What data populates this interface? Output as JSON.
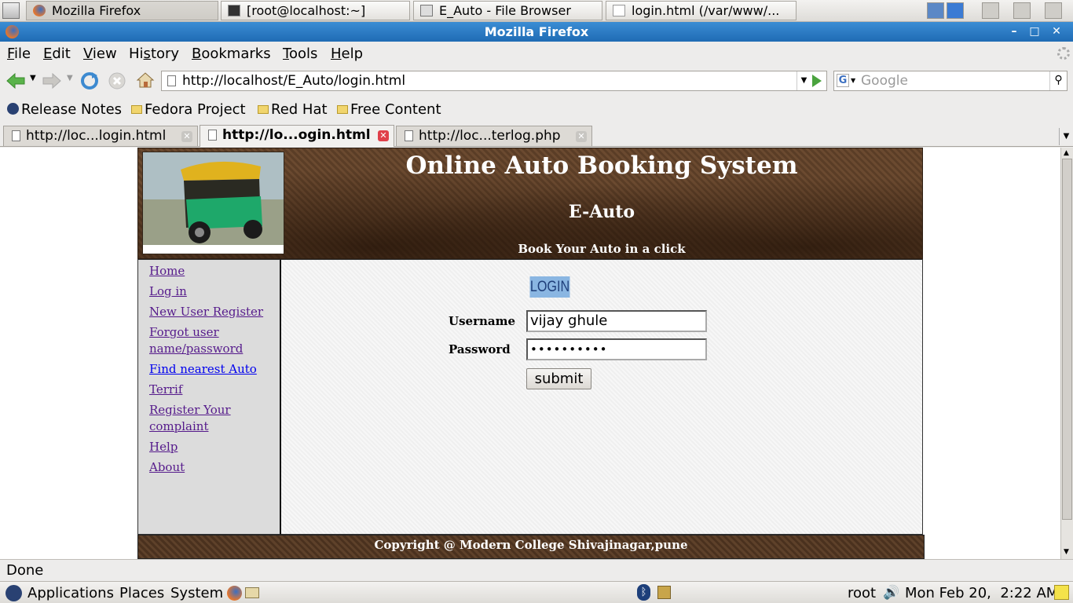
{
  "taskbar": {
    "tasks": [
      {
        "label": "Mozilla Firefox"
      },
      {
        "label": "[root@localhost:~]"
      },
      {
        "label": "E_Auto - File Browser"
      },
      {
        "label": "login.html (/var/www/..."
      }
    ]
  },
  "window": {
    "title": "Mozilla Firefox",
    "min": "–",
    "max": "□",
    "close": "✕"
  },
  "menubar": {
    "file": {
      "u": "F",
      "rest": "ile"
    },
    "edit": {
      "u": "E",
      "rest": "dit"
    },
    "view": {
      "u": "V",
      "rest": "iew"
    },
    "history": {
      "pre": "Hi",
      "u": "s",
      "rest": "tory"
    },
    "bookmarks": {
      "u": "B",
      "rest": "ookmarks"
    },
    "tools": {
      "u": "T",
      "rest": "ools"
    },
    "help": {
      "u": "H",
      "rest": "elp"
    }
  },
  "navbar": {
    "url": "http://localhost/E_Auto/login.html",
    "search_placeholder": "Google"
  },
  "bookmarks": [
    {
      "label": "Release Notes"
    },
    {
      "label": "Fedora Project"
    },
    {
      "label": "Red Hat"
    },
    {
      "label": "Free Content"
    }
  ],
  "tabs": [
    {
      "label": "http://loc...login.html"
    },
    {
      "label": "http://lo...ogin.html"
    },
    {
      "label": "http://loc...terlog.php"
    }
  ],
  "site": {
    "title": "Online Auto Booking System",
    "subtitle": "E-Auto",
    "tagline": "Book Your Auto in a click",
    "nav": [
      "Home",
      "Log in",
      "New User Register",
      "Forgot user name/password",
      "Find nearest Auto",
      "Terrif",
      "Register Your complaint",
      "Help",
      "About"
    ],
    "login_heading": "LOGIN",
    "username_label": "Username",
    "username_value": "vijay ghule",
    "password_label": "Password",
    "password_value": "••••••••••",
    "submit_label": "submit",
    "footer": "Copyright @ Modern College Shivajinagar,pune"
  },
  "status": {
    "text": "Done"
  },
  "panel": {
    "applications": "Applications",
    "places": "Places",
    "system": "System",
    "user": "root",
    "clock": "Mon Feb 20,  2:22 AM"
  },
  "colors": {
    "titlebar": "#1f6bb4",
    "link_visited": "#551a8b",
    "link": "#0000ee",
    "banner": "#5e412a"
  }
}
